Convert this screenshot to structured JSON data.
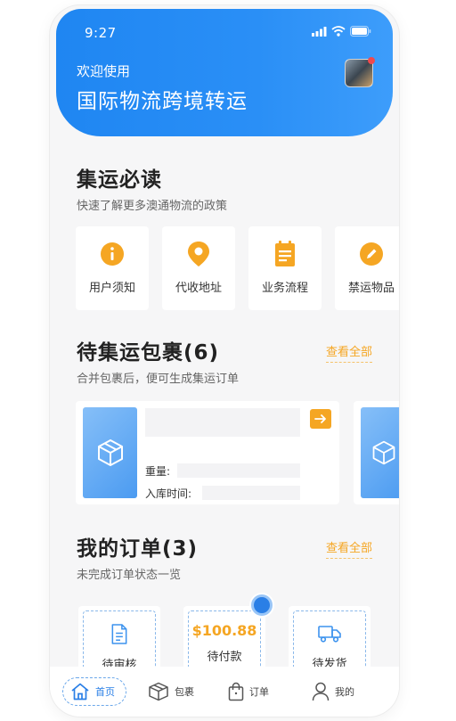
{
  "status": {
    "time": "9:27"
  },
  "header": {
    "welcome": "欢迎使用",
    "title": "国际物流跨境转运"
  },
  "guide": {
    "title": "集运必读",
    "subtitle": "快速了解更多澳通物流的政策",
    "items": [
      {
        "label": "用户须知",
        "icon": "info-icon"
      },
      {
        "label": "代收地址",
        "icon": "location-pin-icon"
      },
      {
        "label": "业务流程",
        "icon": "clipboard-icon"
      },
      {
        "label": "禁运物品",
        "icon": "pencil-icon"
      }
    ]
  },
  "parcels": {
    "title": "待集运包裹(6)",
    "subtitle": "合并包裹后，便可生成集运订单",
    "view_all": "查看全部",
    "weight_label": "重量:",
    "time_label": "入库时间:"
  },
  "orders": {
    "title": "我的订单(3)",
    "subtitle": "未完成订单状态一览",
    "view_all": "查看全部",
    "items": [
      {
        "label": "待审核",
        "icon": "document-icon"
      },
      {
        "label": "待付款",
        "amount": "$100.88"
      },
      {
        "label": "待发货",
        "icon": "truck-icon"
      }
    ]
  },
  "tabbar": {
    "items": [
      {
        "label": "首页",
        "icon": "home-icon",
        "active": true
      },
      {
        "label": "包裹",
        "icon": "box-icon"
      },
      {
        "label": "订单",
        "icon": "bag-icon"
      },
      {
        "label": "我的",
        "icon": "user-icon"
      }
    ]
  },
  "colors": {
    "primary": "#2a8ff6",
    "accent": "#f5a623"
  }
}
